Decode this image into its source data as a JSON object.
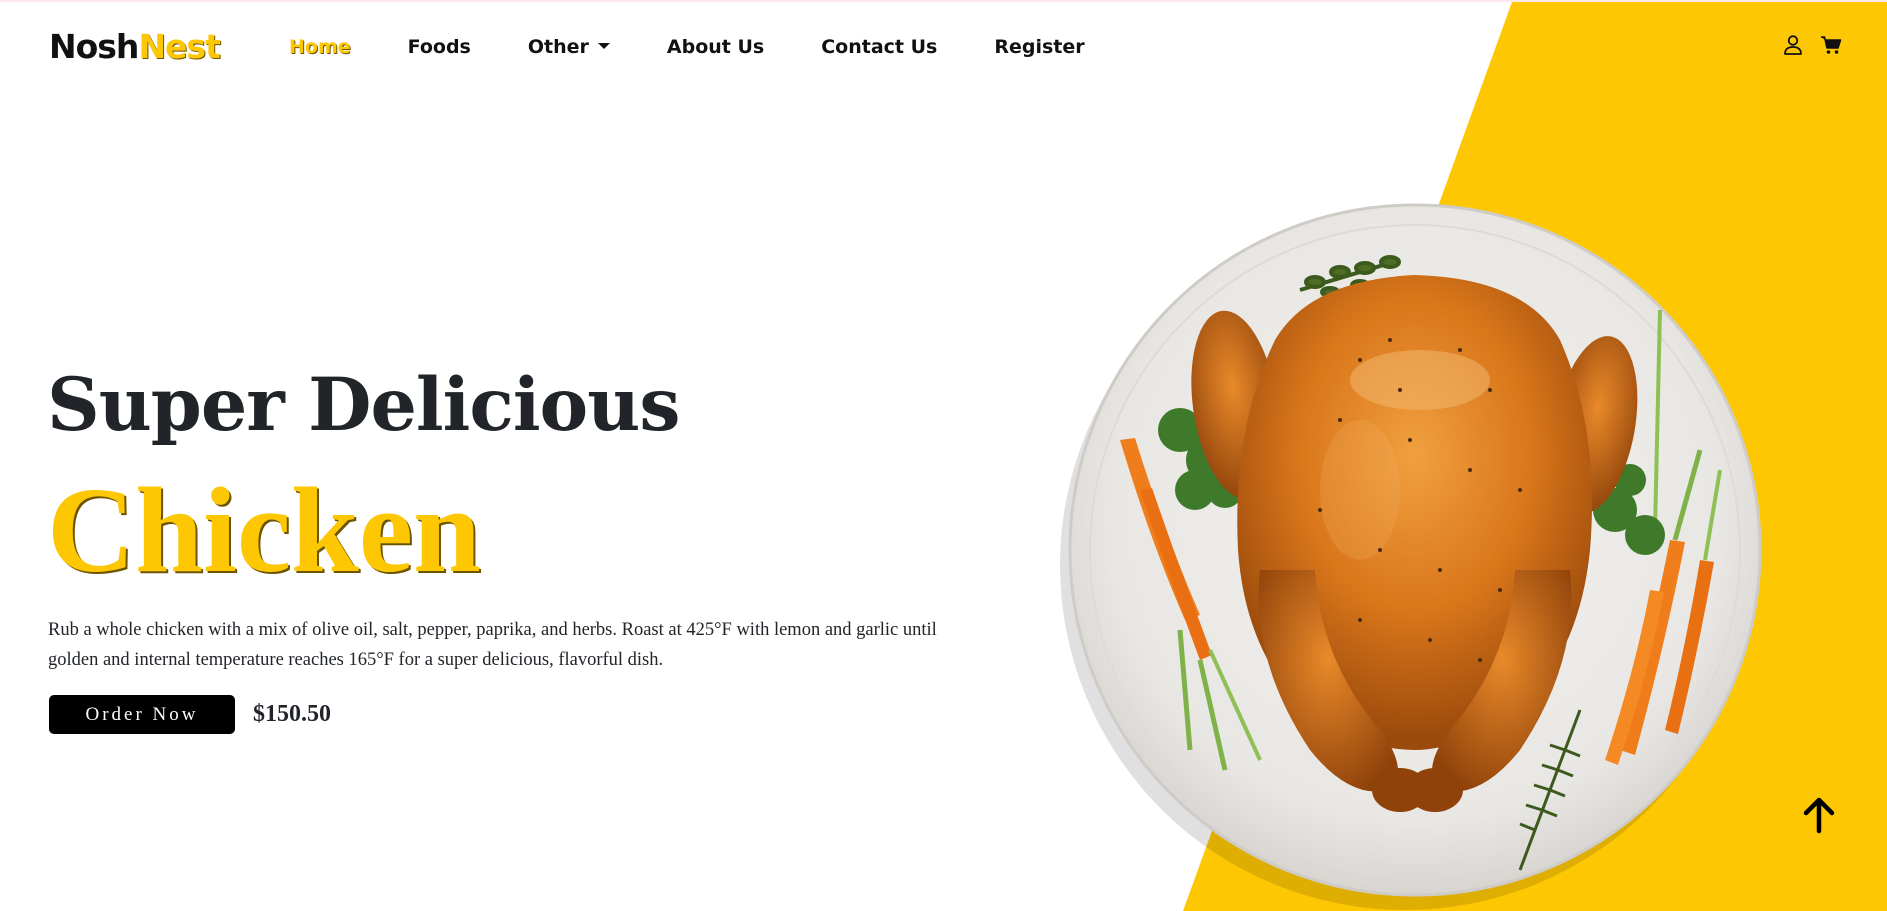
{
  "brand": {
    "part1": "Nosh",
    "part2": "Nest"
  },
  "nav": {
    "items": [
      {
        "label": "Home",
        "active": true
      },
      {
        "label": "Foods",
        "active": false
      },
      {
        "label": "Other",
        "active": false,
        "dropdown": true
      },
      {
        "label": "About Us",
        "active": false
      },
      {
        "label": "Contact Us",
        "active": false
      },
      {
        "label": "Register",
        "active": false
      }
    ],
    "icons": [
      "user-icon",
      "cart-icon"
    ]
  },
  "hero": {
    "title": "Super Delicious",
    "highlight": "Chicken",
    "description": "Rub a whole chicken with a mix of olive oil, salt, pepper, paprika, and herbs. Roast at 425°F with lemon and garlic until golden and internal temperature reaches 165°F for a super delicious, flavorful dish.",
    "order_label": "Order Now",
    "price": "$150.50"
  },
  "colors": {
    "accent": "#fec703",
    "text": "#212529",
    "button_bg": "#000000"
  },
  "scroll_top_icon": "arrow-up-icon"
}
